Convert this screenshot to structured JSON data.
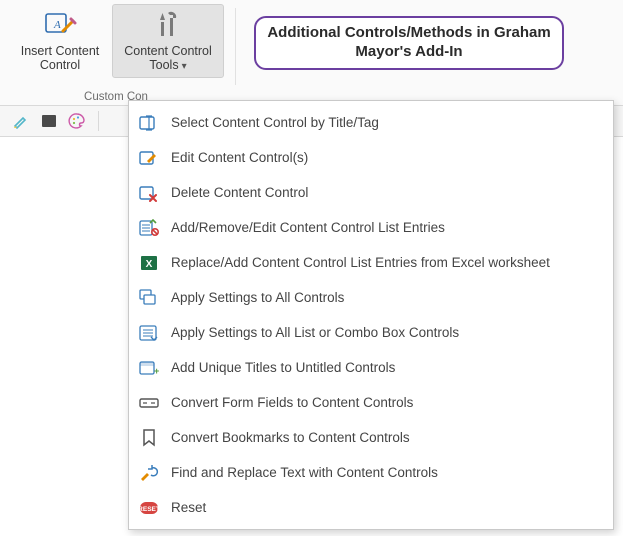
{
  "ribbon": {
    "insert_button": {
      "line1": "Insert Content",
      "line2": "Control"
    },
    "tools_button": {
      "line1": "Content Control",
      "line2": "Tools"
    },
    "group_label": "Custom Con"
  },
  "callout": {
    "text": "Additional Controls/Methods in Graham Mayor's Add-In"
  },
  "menu": {
    "items": [
      {
        "icon": "select-icon",
        "label": "Select Content Control by Title/Tag"
      },
      {
        "icon": "edit-icon",
        "label": "Edit Content Control(s)"
      },
      {
        "icon": "delete-icon",
        "label": "Delete Content Control"
      },
      {
        "icon": "list-edit-icon",
        "label": "Add/Remove/Edit Content Control List Entries"
      },
      {
        "icon": "excel-icon",
        "label": "Replace/Add Content Control List Entries from Excel worksheet"
      },
      {
        "icon": "apply-all-icon",
        "label": "Apply Settings to All Controls"
      },
      {
        "icon": "apply-list-icon",
        "label": "Apply Settings to All List or Combo Box Controls"
      },
      {
        "icon": "unique-title-icon",
        "label": "Add Unique Titles to Untitled Controls"
      },
      {
        "icon": "convert-form-icon",
        "label": "Convert Form Fields to Content Controls"
      },
      {
        "icon": "bookmark-icon",
        "label": "Convert Bookmarks to Content Controls"
      },
      {
        "icon": "find-replace-icon",
        "label": "Find and Replace Text with Content Controls"
      },
      {
        "icon": "reset-icon",
        "label": "Reset"
      }
    ]
  }
}
